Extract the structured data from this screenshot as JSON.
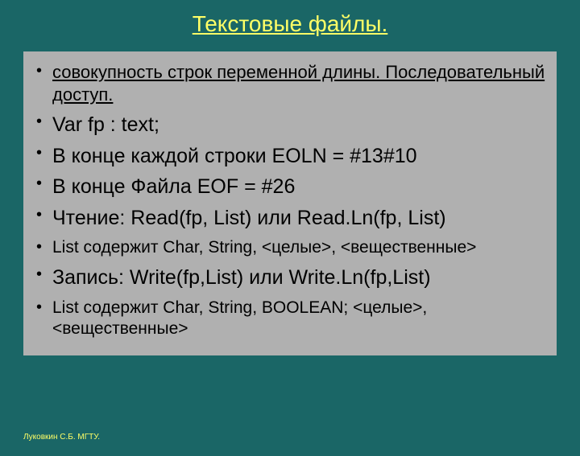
{
  "title": "Текстовые файлы.",
  "items": {
    "i0": "совокупность строк переменной длины. Последовательный доступ.",
    "i1": "Var  fp : text;",
    "i2": "В конце каждой строки EOLN  = #13#10",
    "i3": "В конце Файла  EOF = #26",
    "i4": "Чтение: Read(fp, List) или Read.Ln(fp, List)",
    "i5": "List содержит  Char, String, <целые>, <вещественные>",
    "i6": "Запись: Write(fp,List) или Write.Ln(fp,List)",
    "i7": "List содержит  Char, String, BOOLEAN; <целые>, <вещественные>"
  },
  "footer": "Луковкин С.Б.  МГТУ."
}
